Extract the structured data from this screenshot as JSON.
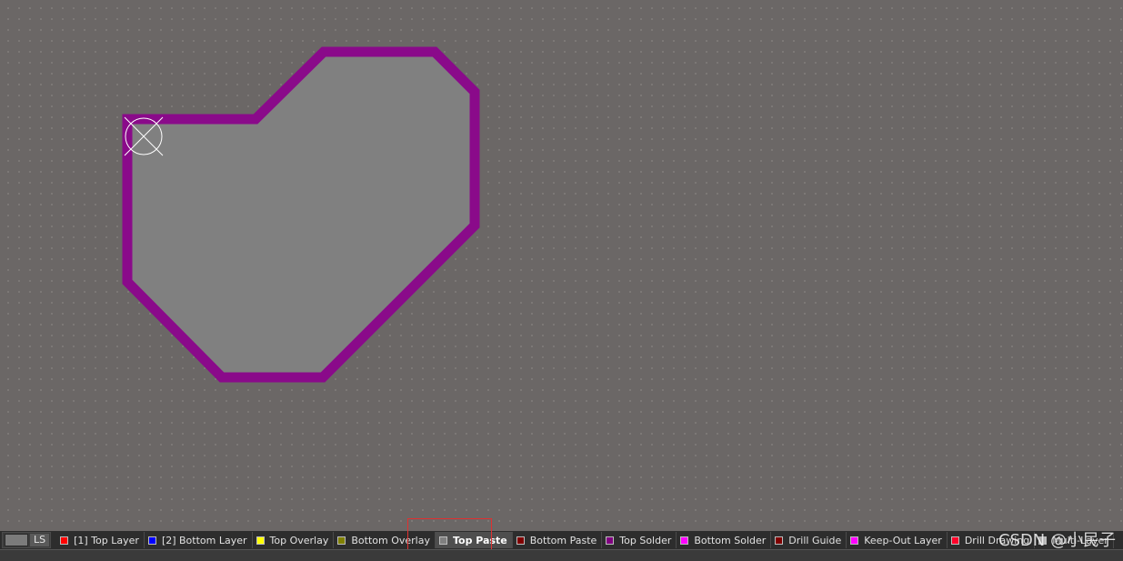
{
  "layer_bar": {
    "ls_label": "LS",
    "tabs": [
      {
        "label": "[1] Top Layer",
        "color": "#ff0000"
      },
      {
        "label": "[2] Bottom Layer",
        "color": "#0000ff"
      },
      {
        "label": "Top Overlay",
        "color": "#ffff00"
      },
      {
        "label": "Bottom Overlay",
        "color": "#808000"
      },
      {
        "label": "Top Paste",
        "color": "#808080",
        "active": true
      },
      {
        "label": "Bottom Paste",
        "color": "#800000"
      },
      {
        "label": "Top Solder",
        "color": "#800080"
      },
      {
        "label": "Bottom Solder",
        "color": "#ff00ff"
      },
      {
        "label": "Drill Guide",
        "color": "#800000"
      },
      {
        "label": "Keep-Out Layer",
        "color": "#ff00ff"
      },
      {
        "label": "Drill Drawing",
        "color": "#ff002a"
      },
      {
        "label": "Multi-Layer",
        "color": "#c0c0c0"
      }
    ]
  },
  "colors": {
    "board_outline": "#8a0a8a",
    "board_fill": "#808080",
    "canvas_background": "#6b6766",
    "highlight_box": "#e03030"
  },
  "watermark": "CSDN @小民子"
}
